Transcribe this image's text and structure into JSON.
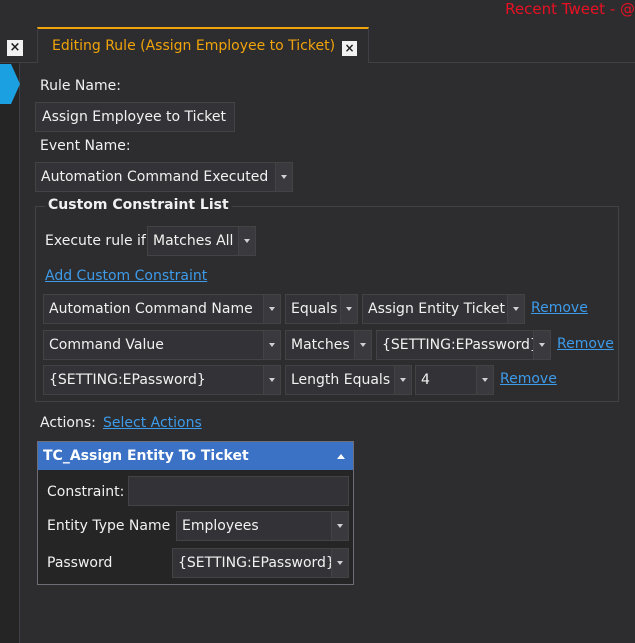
{
  "header": {
    "recent_tweet": "Recent Tweet - @",
    "tab_title": "Editing Rule (Assign Employee to Ticket)",
    "close_glyph": "×"
  },
  "form": {
    "rule_name_label": "Rule Name:",
    "rule_name_value": "Assign Employee to Ticket",
    "event_name_label": "Event Name:",
    "event_name_value": "Automation Command Executed"
  },
  "constraints": {
    "title": "Custom Constraint List",
    "execute_label": "Execute rule if",
    "execute_value": "Matches All",
    "add_link": "Add Custom Constraint",
    "remove_label": "Remove",
    "rows": [
      {
        "field": "Automation Command Name",
        "op": "Equals",
        "value": "Assign Entity Ticket"
      },
      {
        "field": "Command Value",
        "op": "Matches",
        "value": "{SETTING:EPassword}"
      },
      {
        "field": "{SETTING:EPassword}",
        "op": "Length Equals",
        "value": "4"
      }
    ]
  },
  "actions": {
    "label": "Actions:",
    "select_link": "Select Actions",
    "panel_title": "TC_Assign Entity To Ticket",
    "constraint_label": "Constraint:",
    "constraint_value": "",
    "entity_type_label": "Entity Type Name",
    "entity_type_value": "Employees",
    "password_label": "Password",
    "password_value": "{SETTING:EPassword}"
  },
  "icons": [
    "close-icon",
    "pin-icon",
    "dropdown-arrow-icon",
    "collapse-icon"
  ],
  "colors": {
    "accent_tab": "#f0a30a",
    "link": "#3d9be9",
    "panel_header": "#3b72c6",
    "recent_tweet": "#e81123"
  }
}
